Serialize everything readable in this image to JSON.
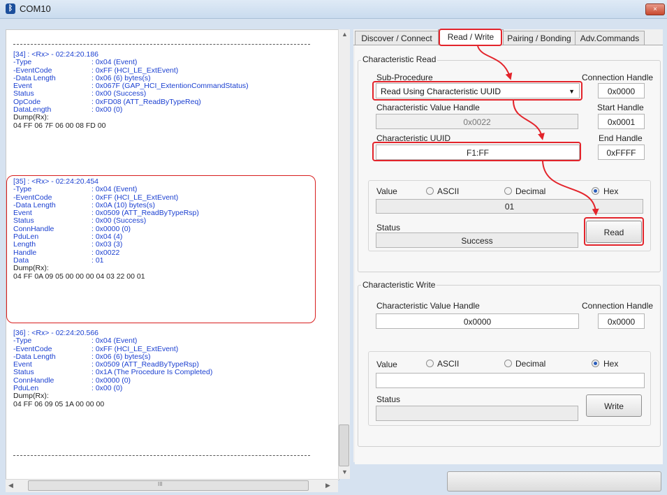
{
  "window": {
    "title": "COM10",
    "icon": "bluetooth-icon",
    "close_label": "×"
  },
  "log": {
    "entries": [
      {
        "header": "[34] : <Rx> - 02:24:20.186",
        "rows": [
          [
            "-Type",
            ": 0x04 (Event)"
          ],
          [
            "-EventCode",
            ": 0xFF (HCI_LE_ExtEvent)"
          ],
          [
            "-Data Length",
            ": 0x06 (6) bytes(s)"
          ],
          [
            " Event",
            ": 0x067F (GAP_HCI_ExtentionCommandStatus)"
          ],
          [
            " Status",
            ": 0x00 (Success)"
          ],
          [
            " OpCode",
            ": 0xFD08 (ATT_ReadByTypeReq)"
          ],
          [
            " DataLength",
            ": 0x00 (0)"
          ]
        ],
        "dump_label": "Dump(Rx):",
        "dump": "04 FF 06 7F 06 00 08 FD 00"
      },
      {
        "header": "[35] : <Rx> - 02:24:20.454",
        "rows": [
          [
            "-Type",
            ": 0x04 (Event)"
          ],
          [
            "-EventCode",
            ": 0xFF (HCI_LE_ExtEvent)"
          ],
          [
            "-Data Length",
            ": 0x0A (10) bytes(s)"
          ],
          [
            " Event",
            ": 0x0509 (ATT_ReadByTypeRsp)"
          ],
          [
            " Status",
            ": 0x00 (Success)"
          ],
          [
            " ConnHandle",
            ": 0x0000 (0)"
          ],
          [
            " PduLen",
            ": 0x04 (4)"
          ],
          [
            " Length",
            ": 0x03 (3)"
          ],
          [
            " Handle",
            ": 0x0022"
          ],
          [
            " Data",
            ": 01"
          ]
        ],
        "dump_label": "Dump(Rx):",
        "dump": "04 FF 0A 09 05 00 00 00 04 03 22 00 01"
      },
      {
        "header": "[36] : <Rx> - 02:24:20.566",
        "rows": [
          [
            "-Type",
            ": 0x04 (Event)"
          ],
          [
            "-EventCode",
            ": 0xFF (HCI_LE_ExtEvent)"
          ],
          [
            "-Data Length",
            ": 0x06 (6) bytes(s)"
          ],
          [
            " Event",
            ": 0x0509 (ATT_ReadByTypeRsp)"
          ],
          [
            " Status",
            ": 0x1A (The Procedure Is Completed)"
          ],
          [
            " ConnHandle",
            ": 0x0000 (0)"
          ],
          [
            " PduLen",
            ": 0x00 (0)"
          ]
        ],
        "dump_label": "Dump(Rx):",
        "dump": "04 FF 06 09 05 1A 00 00 00"
      }
    ],
    "hscroll_grip": "III"
  },
  "tabs": [
    "Discover / Connect",
    "Read / Write",
    "Pairing / Bonding",
    "Adv.Commands"
  ],
  "active_tab": "Read / Write",
  "read": {
    "group_title": "Characteristic Read",
    "sub_procedure_label": "Sub-Procedure",
    "sub_procedure_value": "Read Using Characteristic UUID",
    "connection_handle_label": "Connection Handle",
    "connection_handle_value": "0x0000",
    "value_handle_label": "Characteristic Value Handle",
    "value_handle_value": "0x0022",
    "start_handle_label": "Start Handle",
    "start_handle_value": "0x0001",
    "uuid_label": "Characteristic UUID",
    "uuid_value": "F1:FF",
    "end_handle_label": "End Handle",
    "end_handle_value": "0xFFFF",
    "value_label": "Value",
    "radio_ascii": "ASCII",
    "radio_decimal": "Decimal",
    "radio_hex": "Hex",
    "selected_format": "Hex",
    "value": "01",
    "status_label": "Status",
    "status_value": "Success",
    "button_label": "Read"
  },
  "write": {
    "group_title": "Characteristic Write",
    "value_handle_label": "Characteristic Value Handle",
    "value_handle_value": "0x0000",
    "connection_handle_label": "Connection Handle",
    "connection_handle_value": "0x0000",
    "value_label": "Value",
    "radio_ascii": "ASCII",
    "radio_decimal": "Decimal",
    "radio_hex": "Hex",
    "selected_format": "Hex",
    "value": "",
    "status_label": "Status",
    "status_value": "",
    "button_label": "Write"
  },
  "colors": {
    "log_text": "#1a3fd0",
    "annotation": "#e3242b",
    "radio_selected": "#2a5dbb"
  }
}
